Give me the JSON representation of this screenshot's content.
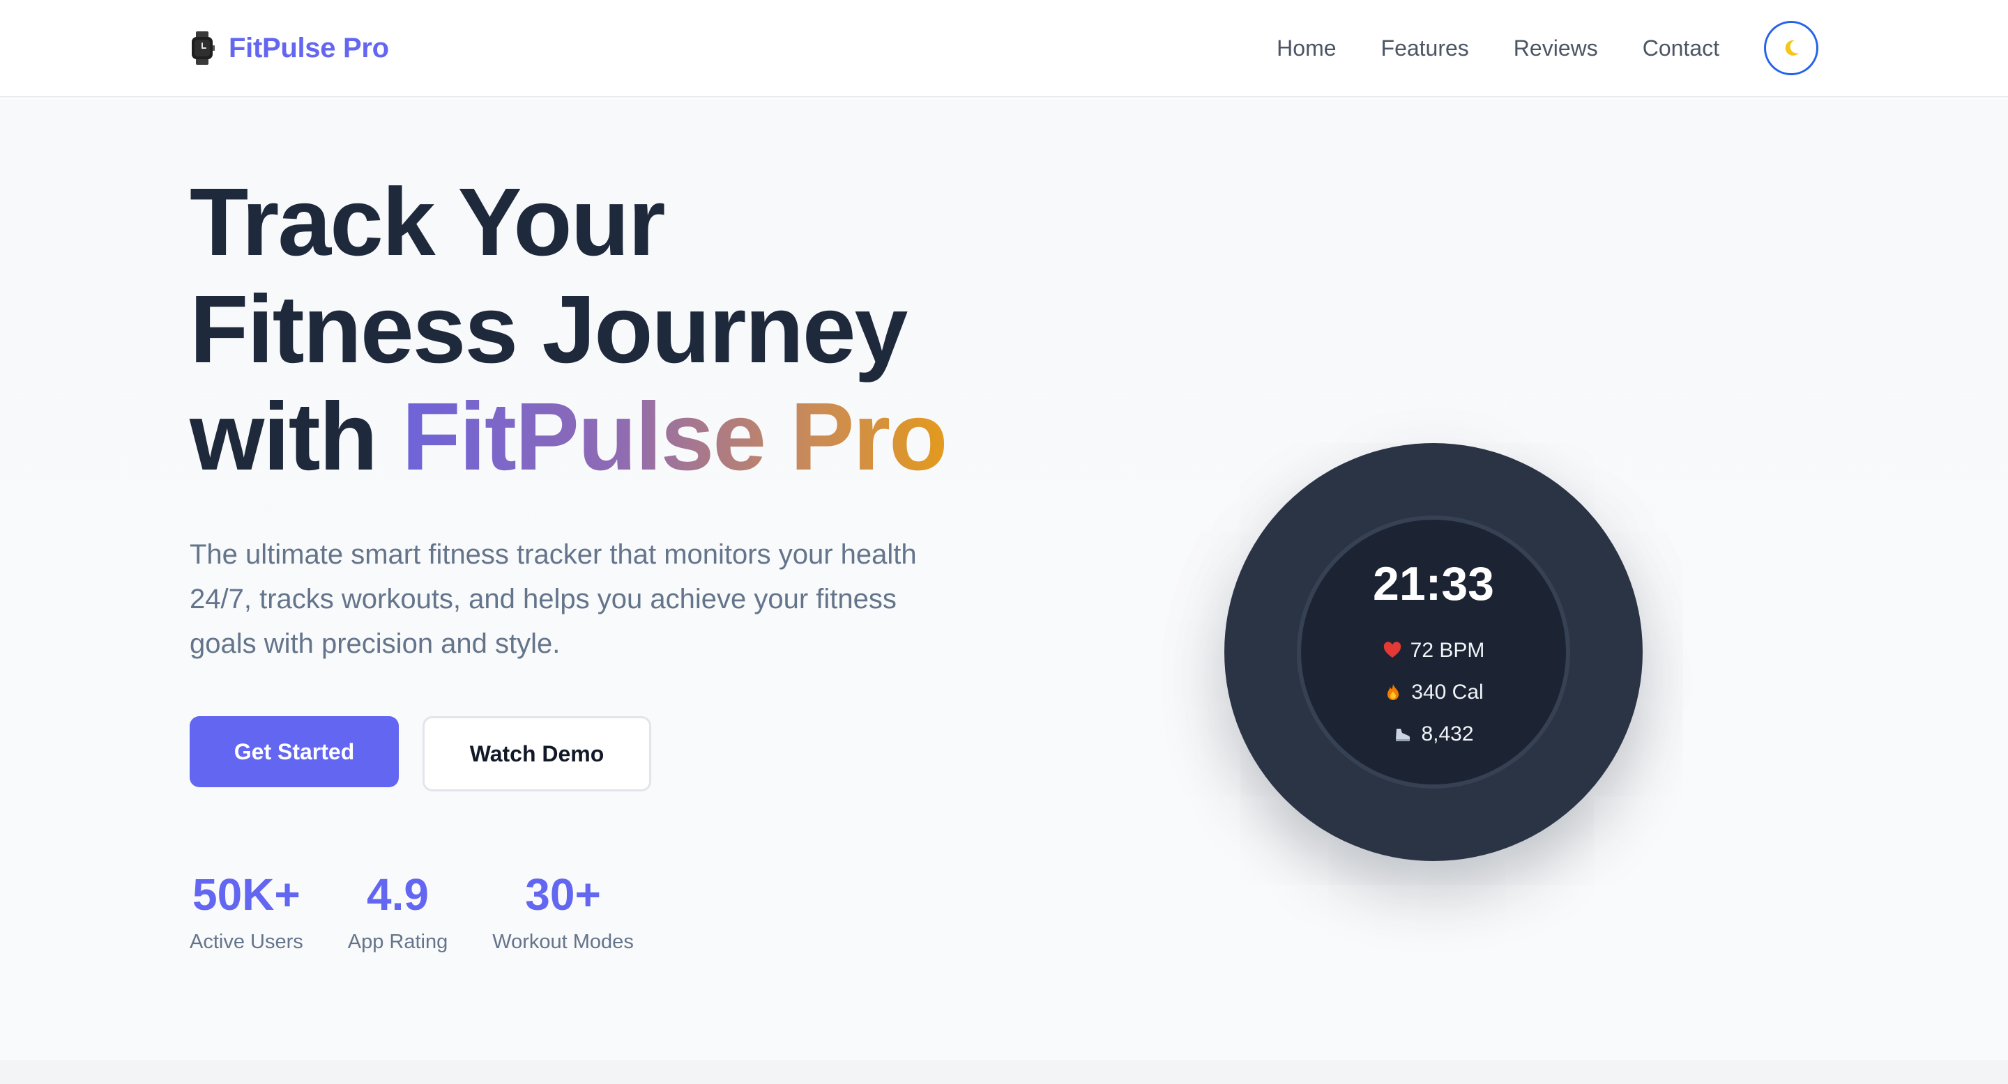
{
  "nav": {
    "brand_icon": "smartwatch-icon",
    "brand_name": "FitPulse Pro",
    "links": [
      "Home",
      "Features",
      "Reviews",
      "Contact"
    ],
    "theme_toggle_icon": "moon-icon"
  },
  "hero": {
    "headline_line1": "Track Your",
    "headline_line2": "Fitness Journey",
    "headline_line3_prefix": "with",
    "headline_highlight": "FitPulse Pro",
    "subtitle": "The ultimate smart fitness tracker that monitors your health 24/7, tracks workouts, and helps you achieve your fitness goals with precision and style.",
    "primary_cta": "Get Started",
    "secondary_cta": "Watch Demo",
    "stats": [
      {
        "value": "50K+",
        "label": "Active Users"
      },
      {
        "value": "4.9",
        "label": "App Rating"
      },
      {
        "value": "30+",
        "label": "Workout Modes"
      }
    ]
  },
  "watch": {
    "time": "21:33",
    "metrics": [
      {
        "icon": "heart-icon",
        "text": "72 BPM"
      },
      {
        "icon": "fire-icon",
        "text": "340 Cal"
      },
      {
        "icon": "shoe-icon",
        "text": "8,432"
      }
    ]
  },
  "colors": {
    "accent": "#6366f1",
    "heading": "#1e293b",
    "muted": "#64748b",
    "watch_body": "#2b3444",
    "gradient_start": "#6e63d9",
    "gradient_end": "#e39a1e"
  }
}
